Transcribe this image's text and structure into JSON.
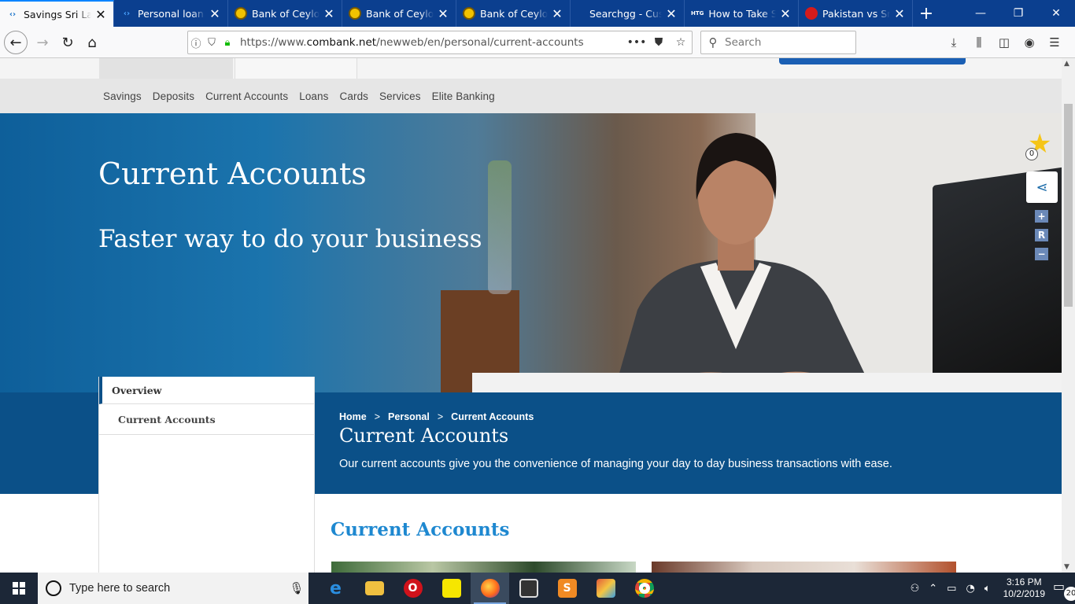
{
  "browser": {
    "tabs": [
      {
        "title": "Savings Sri Lanka",
        "favicon": "combank-icon",
        "active": true
      },
      {
        "title": "Personal loan | ",
        "favicon": "combank-icon",
        "active": false
      },
      {
        "title": "Bank of Ceylon",
        "favicon": "boc-icon",
        "active": false
      },
      {
        "title": "Bank of Ceylon",
        "favicon": "boc-icon",
        "active": false
      },
      {
        "title": "Bank of Ceylon",
        "favicon": "boc-icon",
        "active": false
      },
      {
        "title": "Searchgg - Custom",
        "favicon": "none",
        "active": false
      },
      {
        "title": "How to Take Sc",
        "favicon": "htg-icon",
        "active": false
      },
      {
        "title": "Pakistan vs Sri L",
        "favicon": "cricket-icon",
        "active": false
      }
    ],
    "htg_favicon_text": "HTG",
    "url_prefix": "https://www.",
    "url_domain": "combank.net",
    "url_path": "/newweb/en/personal/current-accounts",
    "search_placeholder": "Search"
  },
  "site": {
    "menu": [
      "Savings",
      "Deposits",
      "Current Accounts",
      "Loans",
      "Cards",
      "Services",
      "Elite Banking"
    ],
    "hero_title": "Current Accounts",
    "hero_subtitle": "Faster way to do your business",
    "favorites_count": "0",
    "zoom_plus": "+",
    "zoom_reset": "R",
    "zoom_minus": "−",
    "sidenav": {
      "overview": "Overview",
      "item": "Current Accounts"
    },
    "breadcrumb": [
      "Home",
      "Personal",
      "Current Accounts"
    ],
    "breadcrumb_sep": ">",
    "section_title": "Current Accounts",
    "section_desc": "Our current accounts give you the convenience of managing your day to day business transactions with ease.",
    "content_heading": "Current Accounts"
  },
  "taskbar": {
    "search_placeholder": "Type here to search",
    "time": "3:16 PM",
    "date": "10/2/2019",
    "notifications": "20"
  },
  "colors": {
    "tabstrip": "#0b3f8f",
    "site_blue": "#0b5088",
    "heading_blue": "#1e88d0"
  }
}
